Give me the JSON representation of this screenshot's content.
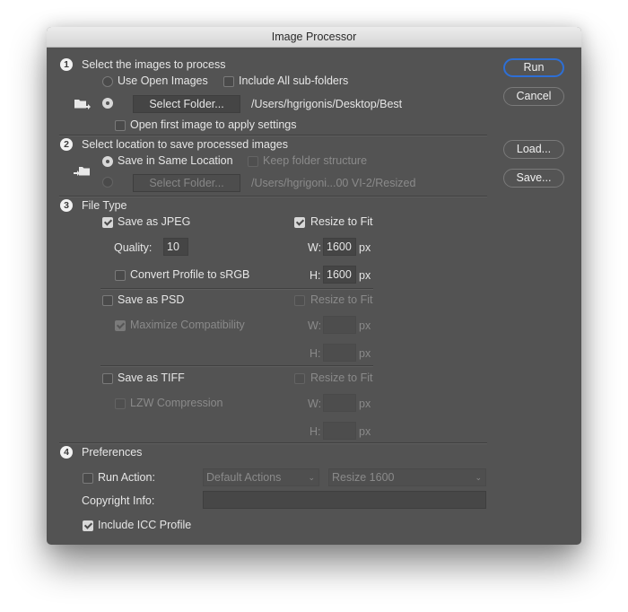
{
  "window": {
    "title": "Image Processor"
  },
  "buttons": {
    "run": "Run",
    "cancel": "Cancel",
    "load": "Load...",
    "save": "Save..."
  },
  "section1": {
    "number": "1",
    "title": "Select the images to process",
    "use_open_images": {
      "label": "Use Open Images",
      "selected": false
    },
    "include_subfolders": {
      "label": "Include All sub-folders",
      "checked": false
    },
    "select_folder": {
      "label": "Select Folder...",
      "selected": true,
      "path": "/Users/hgrigonis/Desktop/Best"
    },
    "open_first_image": {
      "label": "Open first image to apply settings",
      "checked": false
    },
    "icon": "folder-arrow-icon"
  },
  "section2": {
    "number": "2",
    "title": "Select location to save processed images",
    "save_same_location": {
      "label": "Save in Same Location",
      "selected": true
    },
    "keep_folder_structure": {
      "label": "Keep folder structure",
      "checked": false,
      "enabled": false
    },
    "select_folder": {
      "label": "Select Folder...",
      "selected": false,
      "enabled": false,
      "path": "/Users/hgrigoni...00 VI-2/Resized"
    },
    "icon": "arrow-folder-icon"
  },
  "section3": {
    "number": "3",
    "title": "File Type",
    "jpeg": {
      "label": "Save as JPEG",
      "checked": true,
      "quality_label": "Quality:",
      "quality_value": "10",
      "convert_srgb": {
        "label": "Convert Profile to sRGB",
        "checked": false
      },
      "resize": {
        "label": "Resize to Fit",
        "checked": true,
        "w_label": "W:",
        "w_value": "1600",
        "h_label": "H:",
        "h_value": "1600",
        "unit": "px"
      }
    },
    "psd": {
      "label": "Save as PSD",
      "checked": false,
      "max_compat": {
        "label": "Maximize Compatibility",
        "checked": true,
        "enabled": false
      },
      "resize": {
        "label": "Resize to Fit",
        "checked": false,
        "enabled": false,
        "w_label": "W:",
        "w_value": "",
        "h_label": "H:",
        "h_value": "",
        "unit": "px"
      }
    },
    "tiff": {
      "label": "Save as TIFF",
      "checked": false,
      "lzw": {
        "label": "LZW Compression",
        "checked": false,
        "enabled": false
      },
      "resize": {
        "label": "Resize to Fit",
        "checked": false,
        "enabled": false,
        "w_label": "W:",
        "w_value": "",
        "h_label": "H:",
        "h_value": "",
        "unit": "px"
      }
    }
  },
  "section4": {
    "number": "4",
    "title": "Preferences",
    "run_action": {
      "label": "Run Action:",
      "checked": false,
      "set_value": "Default Actions",
      "action_value": "Resize 1600"
    },
    "copyright": {
      "label": "Copyright Info:",
      "value": ""
    },
    "include_icc": {
      "label": "Include ICC Profile",
      "checked": true
    }
  },
  "colors": {
    "dialog_bg": "#535353",
    "default_button_ring": "#2d6fd6",
    "titlebar": "#e0e0e0"
  }
}
